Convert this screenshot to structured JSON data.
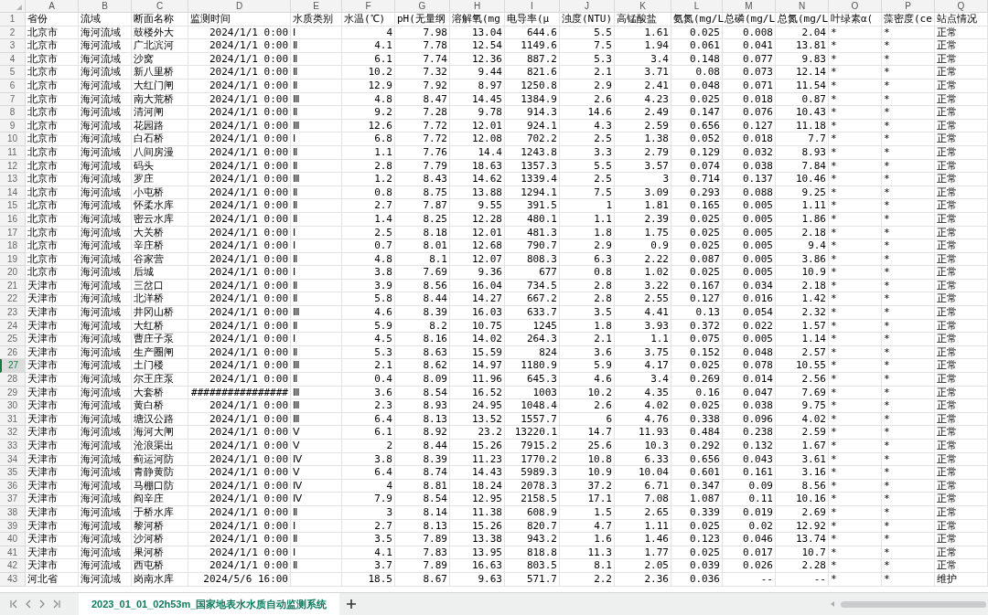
{
  "columns": [
    {
      "letter": "A",
      "kind": "text"
    },
    {
      "letter": "B",
      "kind": "text"
    },
    {
      "letter": "C",
      "kind": "text"
    },
    {
      "letter": "D",
      "kind": "number"
    },
    {
      "letter": "E",
      "kind": "text"
    },
    {
      "letter": "F",
      "kind": "number"
    },
    {
      "letter": "G",
      "kind": "number"
    },
    {
      "letter": "H",
      "kind": "number"
    },
    {
      "letter": "I",
      "kind": "number"
    },
    {
      "letter": "J",
      "kind": "number"
    },
    {
      "letter": "K",
      "kind": "number"
    },
    {
      "letter": "L",
      "kind": "number"
    },
    {
      "letter": "M",
      "kind": "number"
    },
    {
      "letter": "N",
      "kind": "number"
    },
    {
      "letter": "O",
      "kind": "text"
    },
    {
      "letter": "P",
      "kind": "text"
    },
    {
      "letter": "Q",
      "kind": "text"
    }
  ],
  "rows": [
    {
      "number": "1",
      "kind": "header",
      "selected": false,
      "cells": [
        "省份",
        "流域",
        "断面名称",
        "监测时间",
        "水质类别",
        "水温(℃)",
        "pH(无量纲",
        "溶解氧(mg",
        "电导率(μ",
        "浊度(NTU)",
        "高锰酸盐",
        "氨氮(mg/L",
        "总磷(mg/L",
        "总氮(mg/L",
        "叶绿素α(",
        "藻密度(ce",
        "站点情况"
      ]
    },
    {
      "number": "2",
      "kind": "data",
      "selected": false,
      "cells": [
        "北京市",
        "海河流域",
        "鼓楼外大",
        "2024/1/1 0:00",
        "Ⅰ",
        "4",
        "7.98",
        "13.04",
        "644.6",
        "5.5",
        "1.61",
        "0.025",
        "0.008",
        "2.04",
        "*",
        "*",
        "正常"
      ]
    },
    {
      "number": "3",
      "kind": "data",
      "selected": false,
      "cells": [
        "北京市",
        "海河流域",
        "广北滨河",
        "2024/1/1 0:00",
        "Ⅱ",
        "4.1",
        "7.78",
        "12.54",
        "1149.6",
        "7.5",
        "1.94",
        "0.061",
        "0.041",
        "13.81",
        "*",
        "*",
        "正常"
      ]
    },
    {
      "number": "4",
      "kind": "data",
      "selected": false,
      "cells": [
        "北京市",
        "海河流域",
        "沙窝",
        "2024/1/1 0:00",
        "Ⅱ",
        "6.1",
        "7.74",
        "12.36",
        "887.2",
        "5.3",
        "3.4",
        "0.148",
        "0.077",
        "9.83",
        "*",
        "*",
        "正常"
      ]
    },
    {
      "number": "5",
      "kind": "data",
      "selected": false,
      "cells": [
        "北京市",
        "海河流域",
        "新八里桥",
        "2024/1/1 0:00",
        "Ⅱ",
        "10.2",
        "7.32",
        "9.44",
        "821.6",
        "2.1",
        "3.71",
        "0.08",
        "0.073",
        "12.14",
        "*",
        "*",
        "正常"
      ]
    },
    {
      "number": "6",
      "kind": "data",
      "selected": false,
      "cells": [
        "北京市",
        "海河流域",
        "大红门闸",
        "2024/1/1 0:00",
        "Ⅱ",
        "12.9",
        "7.92",
        "8.97",
        "1250.8",
        "2.9",
        "2.41",
        "0.048",
        "0.071",
        "11.54",
        "*",
        "*",
        "正常"
      ]
    },
    {
      "number": "7",
      "kind": "data",
      "selected": false,
      "cells": [
        "北京市",
        "海河流域",
        "南大荒桥",
        "2024/1/1 0:00",
        "Ⅲ",
        "4.8",
        "8.47",
        "14.45",
        "1384.9",
        "2.6",
        "4.23",
        "0.025",
        "0.018",
        "0.87",
        "*",
        "*",
        "正常"
      ]
    },
    {
      "number": "8",
      "kind": "data",
      "selected": false,
      "cells": [
        "北京市",
        "海河流域",
        "清河闸",
        "2024/1/1 0:00",
        "Ⅱ",
        "9.2",
        "7.28",
        "9.78",
        "914.3",
        "14.6",
        "2.49",
        "0.147",
        "0.076",
        "10.43",
        "*",
        "*",
        "正常"
      ]
    },
    {
      "number": "9",
      "kind": "data",
      "selected": false,
      "cells": [
        "北京市",
        "海河流域",
        "花园路",
        "2024/1/1 0:00",
        "Ⅲ",
        "12.6",
        "7.72",
        "12.01",
        "924.1",
        "4.3",
        "2.59",
        "0.656",
        "0.127",
        "11.18",
        "*",
        "*",
        "正常"
      ]
    },
    {
      "number": "10",
      "kind": "data",
      "selected": false,
      "cells": [
        "北京市",
        "海河流域",
        "白石桥",
        "2024/1/1 0:00",
        "Ⅰ",
        "6.8",
        "7.72",
        "12.08",
        "702.2",
        "2.5",
        "1.38",
        "0.052",
        "0.018",
        "7.7",
        "*",
        "*",
        "正常"
      ]
    },
    {
      "number": "11",
      "kind": "data",
      "selected": false,
      "cells": [
        "北京市",
        "海河流域",
        "八间房漫",
        "2024/1/1 0:00",
        "Ⅱ",
        "1.1",
        "7.76",
        "14.4",
        "1243.8",
        "3.3",
        "2.79",
        "0.129",
        "0.032",
        "8.93",
        "*",
        "*",
        "正常"
      ]
    },
    {
      "number": "12",
      "kind": "data",
      "selected": false,
      "cells": [
        "北京市",
        "海河流域",
        "码头",
        "2024/1/1 0:00",
        "Ⅱ",
        "2.8",
        "7.79",
        "18.63",
        "1357.3",
        "5.5",
        "3.57",
        "0.074",
        "0.038",
        "7.84",
        "*",
        "*",
        "正常"
      ]
    },
    {
      "number": "13",
      "kind": "data",
      "selected": false,
      "cells": [
        "北京市",
        "海河流域",
        "罗庄",
        "2024/1/1 0:00",
        "Ⅲ",
        "1.2",
        "8.43",
        "14.62",
        "1339.4",
        "2.5",
        "3",
        "0.714",
        "0.137",
        "10.46",
        "*",
        "*",
        "正常"
      ]
    },
    {
      "number": "14",
      "kind": "data",
      "selected": false,
      "cells": [
        "北京市",
        "海河流域",
        "小屯桥",
        "2024/1/1 0:00",
        "Ⅱ",
        "0.8",
        "8.75",
        "13.88",
        "1294.1",
        "7.5",
        "3.09",
        "0.293",
        "0.088",
        "9.25",
        "*",
        "*",
        "正常"
      ]
    },
    {
      "number": "15",
      "kind": "data",
      "selected": false,
      "cells": [
        "北京市",
        "海河流域",
        "怀柔水库",
        "2024/1/1 0:00",
        "Ⅱ",
        "2.7",
        "7.87",
        "9.55",
        "391.5",
        "1",
        "1.81",
        "0.165",
        "0.005",
        "1.11",
        "*",
        "*",
        "正常"
      ]
    },
    {
      "number": "16",
      "kind": "data",
      "selected": false,
      "cells": [
        "北京市",
        "海河流域",
        "密云水库",
        "2024/1/1 0:00",
        "Ⅱ",
        "1.4",
        "8.25",
        "12.28",
        "480.1",
        "1.1",
        "2.39",
        "0.025",
        "0.005",
        "1.86",
        "*",
        "*",
        "正常"
      ]
    },
    {
      "number": "17",
      "kind": "data",
      "selected": false,
      "cells": [
        "北京市",
        "海河流域",
        "大关桥",
        "2024/1/1 0:00",
        "Ⅰ",
        "2.5",
        "8.18",
        "12.01",
        "481.3",
        "1.8",
        "1.75",
        "0.025",
        "0.005",
        "2.18",
        "*",
        "*",
        "正常"
      ]
    },
    {
      "number": "18",
      "kind": "data",
      "selected": false,
      "cells": [
        "北京市",
        "海河流域",
        "辛庄桥",
        "2024/1/1 0:00",
        "Ⅰ",
        "0.7",
        "8.01",
        "12.68",
        "790.7",
        "2.9",
        "0.9",
        "0.025",
        "0.005",
        "9.4",
        "*",
        "*",
        "正常"
      ]
    },
    {
      "number": "19",
      "kind": "data",
      "selected": false,
      "cells": [
        "北京市",
        "海河流域",
        "谷家营",
        "2024/1/1 0:00",
        "Ⅱ",
        "4.8",
        "8.1",
        "12.07",
        "808.3",
        "6.3",
        "2.22",
        "0.087",
        "0.005",
        "3.86",
        "*",
        "*",
        "正常"
      ]
    },
    {
      "number": "20",
      "kind": "data",
      "selected": false,
      "cells": [
        "北京市",
        "海河流域",
        "后城",
        "2024/1/1 0:00",
        "Ⅰ",
        "3.8",
        "7.69",
        "9.36",
        "677",
        "0.8",
        "1.02",
        "0.025",
        "0.005",
        "10.9",
        "*",
        "*",
        "正常"
      ]
    },
    {
      "number": "21",
      "kind": "data",
      "selected": false,
      "cells": [
        "天津市",
        "海河流域",
        "三岔口",
        "2024/1/1 0:00",
        "Ⅱ",
        "3.9",
        "8.56",
        "16.04",
        "734.5",
        "2.8",
        "3.22",
        "0.167",
        "0.034",
        "2.18",
        "*",
        "*",
        "正常"
      ]
    },
    {
      "number": "22",
      "kind": "data",
      "selected": false,
      "cells": [
        "天津市",
        "海河流域",
        "北洋桥",
        "2024/1/1 0:00",
        "Ⅱ",
        "5.8",
        "8.44",
        "14.27",
        "667.2",
        "2.8",
        "2.55",
        "0.127",
        "0.016",
        "1.42",
        "*",
        "*",
        "正常"
      ]
    },
    {
      "number": "23",
      "kind": "data",
      "selected": false,
      "cells": [
        "天津市",
        "海河流域",
        "井冈山桥",
        "2024/1/1 0:00",
        "Ⅲ",
        "4.6",
        "8.39",
        "16.03",
        "633.7",
        "3.5",
        "4.41",
        "0.13",
        "0.054",
        "2.32",
        "*",
        "*",
        "正常"
      ]
    },
    {
      "number": "24",
      "kind": "data",
      "selected": false,
      "cells": [
        "天津市",
        "海河流域",
        "大红桥",
        "2024/1/1 0:00",
        "Ⅱ",
        "5.9",
        "8.2",
        "10.75",
        "1245",
        "1.8",
        "3.93",
        "0.372",
        "0.022",
        "1.57",
        "*",
        "*",
        "正常"
      ]
    },
    {
      "number": "25",
      "kind": "data",
      "selected": false,
      "cells": [
        "天津市",
        "海河流域",
        "曹庄子泵",
        "2024/1/1 0:00",
        "Ⅰ",
        "4.5",
        "8.16",
        "14.02",
        "264.3",
        "2.1",
        "1.1",
        "0.075",
        "0.005",
        "1.14",
        "*",
        "*",
        "正常"
      ]
    },
    {
      "number": "26",
      "kind": "data",
      "selected": false,
      "cells": [
        "天津市",
        "海河流域",
        "生产圈闸",
        "2024/1/1 0:00",
        "Ⅱ",
        "5.3",
        "8.63",
        "15.59",
        "824",
        "3.6",
        "3.75",
        "0.152",
        "0.048",
        "2.57",
        "*",
        "*",
        "正常"
      ]
    },
    {
      "number": "27",
      "kind": "data",
      "selected": true,
      "cells": [
        "天津市",
        "海河流域",
        "土门楼",
        "2024/1/1 0:00",
        "Ⅲ",
        "2.1",
        "8.62",
        "14.97",
        "1180.9",
        "5.9",
        "4.17",
        "0.025",
        "0.078",
        "10.55",
        "*",
        "*",
        "正常"
      ]
    },
    {
      "number": "28",
      "kind": "data",
      "selected": false,
      "cells": [
        "天津市",
        "海河流域",
        "尔王庄泵",
        "2024/1/1 0:00",
        "Ⅱ",
        "0.4",
        "8.09",
        "11.96",
        "645.3",
        "4.6",
        "3.4",
        "0.269",
        "0.014",
        "2.56",
        "*",
        "*",
        "正常"
      ]
    },
    {
      "number": "29",
      "kind": "data",
      "selected": false,
      "cells": [
        "天津市",
        "海河流域",
        "大套桥",
        "################",
        "Ⅲ",
        "3.6",
        "8.54",
        "16.52",
        "1003",
        "10.2",
        "4.35",
        "0.16",
        "0.047",
        "7.69",
        "*",
        "*",
        "正常"
      ]
    },
    {
      "number": "30",
      "kind": "data",
      "selected": false,
      "cells": [
        "天津市",
        "海河流域",
        "黄白桥",
        "2024/1/1 0:00",
        "Ⅲ",
        "2.3",
        "8.93",
        "24.95",
        "1048.4",
        "2.6",
        "4.02",
        "0.025",
        "0.038",
        "9.75",
        "*",
        "*",
        "正常"
      ]
    },
    {
      "number": "31",
      "kind": "data",
      "selected": false,
      "cells": [
        "天津市",
        "海河流域",
        "塘汉公路",
        "2024/1/1 0:00",
        "Ⅲ",
        "6.4",
        "8.13",
        "13.52",
        "1557.7",
        "6",
        "4.76",
        "0.338",
        "0.096",
        "4.02",
        "*",
        "*",
        "正常"
      ]
    },
    {
      "number": "32",
      "kind": "data",
      "selected": false,
      "cells": [
        "天津市",
        "海河流域",
        "海河大闸",
        "2024/1/1 0:00",
        "Ⅴ",
        "6.1",
        "8.92",
        "23.2",
        "13220.1",
        "14.7",
        "11.93",
        "0.484",
        "0.238",
        "2.59",
        "*",
        "*",
        "正常"
      ]
    },
    {
      "number": "33",
      "kind": "data",
      "selected": false,
      "cells": [
        "天津市",
        "海河流域",
        "沧浪渠出",
        "2024/1/1 0:00",
        "Ⅴ",
        "2",
        "8.44",
        "15.26",
        "7915.2",
        "25.6",
        "10.3",
        "0.292",
        "0.132",
        "1.67",
        "*",
        "*",
        "正常"
      ]
    },
    {
      "number": "34",
      "kind": "data",
      "selected": false,
      "cells": [
        "天津市",
        "海河流域",
        "蓟运河防",
        "2024/1/1 0:00",
        "Ⅳ",
        "3.8",
        "8.39",
        "11.23",
        "1770.2",
        "10.8",
        "6.33",
        "0.656",
        "0.043",
        "3.61",
        "*",
        "*",
        "正常"
      ]
    },
    {
      "number": "35",
      "kind": "data",
      "selected": false,
      "cells": [
        "天津市",
        "海河流域",
        "青静黄防",
        "2024/1/1 0:00",
        "Ⅴ",
        "6.4",
        "8.74",
        "14.43",
        "5989.3",
        "10.9",
        "10.04",
        "0.601",
        "0.161",
        "3.16",
        "*",
        "*",
        "正常"
      ]
    },
    {
      "number": "36",
      "kind": "data",
      "selected": false,
      "cells": [
        "天津市",
        "海河流域",
        "马棚口防",
        "2024/1/1 0:00",
        "Ⅳ",
        "4",
        "8.81",
        "18.24",
        "2078.3",
        "37.2",
        "6.71",
        "0.347",
        "0.09",
        "8.56",
        "*",
        "*",
        "正常"
      ]
    },
    {
      "number": "37",
      "kind": "data",
      "selected": false,
      "cells": [
        "天津市",
        "海河流域",
        "阎辛庄",
        "2024/1/1 0:00",
        "Ⅳ",
        "7.9",
        "8.54",
        "12.95",
        "2158.5",
        "17.1",
        "7.08",
        "1.087",
        "0.11",
        "10.16",
        "*",
        "*",
        "正常"
      ]
    },
    {
      "number": "38",
      "kind": "data",
      "selected": false,
      "cells": [
        "天津市",
        "海河流域",
        "于桥水库",
        "2024/1/1 0:00",
        "Ⅱ",
        "3",
        "8.14",
        "11.38",
        "608.9",
        "1.5",
        "2.65",
        "0.339",
        "0.019",
        "2.69",
        "*",
        "*",
        "正常"
      ]
    },
    {
      "number": "39",
      "kind": "data",
      "selected": false,
      "cells": [
        "天津市",
        "海河流域",
        "黎河桥",
        "2024/1/1 0:00",
        "Ⅰ",
        "2.7",
        "8.13",
        "15.26",
        "820.7",
        "4.7",
        "1.11",
        "0.025",
        "0.02",
        "12.92",
        "*",
        "*",
        "正常"
      ]
    },
    {
      "number": "40",
      "kind": "data",
      "selected": false,
      "cells": [
        "天津市",
        "海河流域",
        "沙河桥",
        "2024/1/1 0:00",
        "Ⅱ",
        "3.5",
        "7.89",
        "13.38",
        "943.2",
        "1.6",
        "1.46",
        "0.123",
        "0.046",
        "13.74",
        "*",
        "*",
        "正常"
      ]
    },
    {
      "number": "41",
      "kind": "data",
      "selected": false,
      "cells": [
        "天津市",
        "海河流域",
        "果河桥",
        "2024/1/1 0:00",
        "Ⅰ",
        "4.1",
        "7.83",
        "13.95",
        "818.8",
        "11.3",
        "1.77",
        "0.025",
        "0.017",
        "10.7",
        "*",
        "*",
        "正常"
      ]
    },
    {
      "number": "42",
      "kind": "data",
      "selected": false,
      "cells": [
        "天津市",
        "海河流域",
        "西屯桥",
        "2024/1/1 0:00",
        "Ⅱ",
        "3.7",
        "7.89",
        "16.63",
        "803.5",
        "8.1",
        "2.05",
        "0.039",
        "0.026",
        "2.28",
        "*",
        "*",
        "正常"
      ]
    },
    {
      "number": "43",
      "kind": "data",
      "selected": false,
      "cells": [
        "河北省",
        "海河流域",
        "岗南水库",
        "2024/5/6 16:00",
        null,
        "18.5",
        "8.67",
        "9.63",
        "571.7",
        "2.2",
        "2.36",
        "0.036",
        "--",
        "--",
        "*",
        "*",
        "维护"
      ]
    }
  ],
  "sheet_tabs": [
    {
      "label": "2023_01_01_02h53m_国家地表水水质自动监测系统",
      "selected": true
    }
  ]
}
